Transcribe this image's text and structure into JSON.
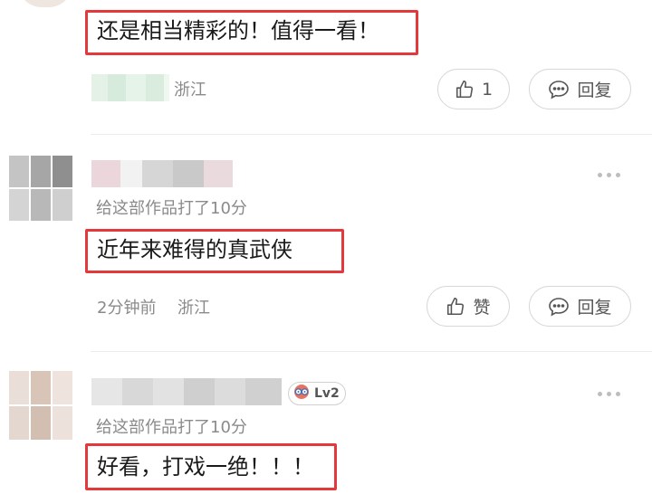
{
  "comments": [
    {
      "text": "还是相当精彩的！值得一看！",
      "location": "浙江",
      "like_count": "1",
      "reply_label": "回复"
    },
    {
      "score_text": "给这部作品打了10分",
      "text": "近年来难得的真武侠",
      "time": "2分钟前",
      "location": "浙江",
      "like_label": "赞",
      "reply_label": "回复"
    },
    {
      "level": "Lv2",
      "score_text": "给这部作品打了10分",
      "text": "好看，打戏一绝！！！"
    }
  ],
  "colors": {
    "highlight_border": "#e4393c",
    "meta_text": "#8a8a8a"
  },
  "icons": [
    "thumb-up-icon",
    "chat-bubble-icon",
    "more-dots-icon",
    "level-badge-icon"
  ]
}
